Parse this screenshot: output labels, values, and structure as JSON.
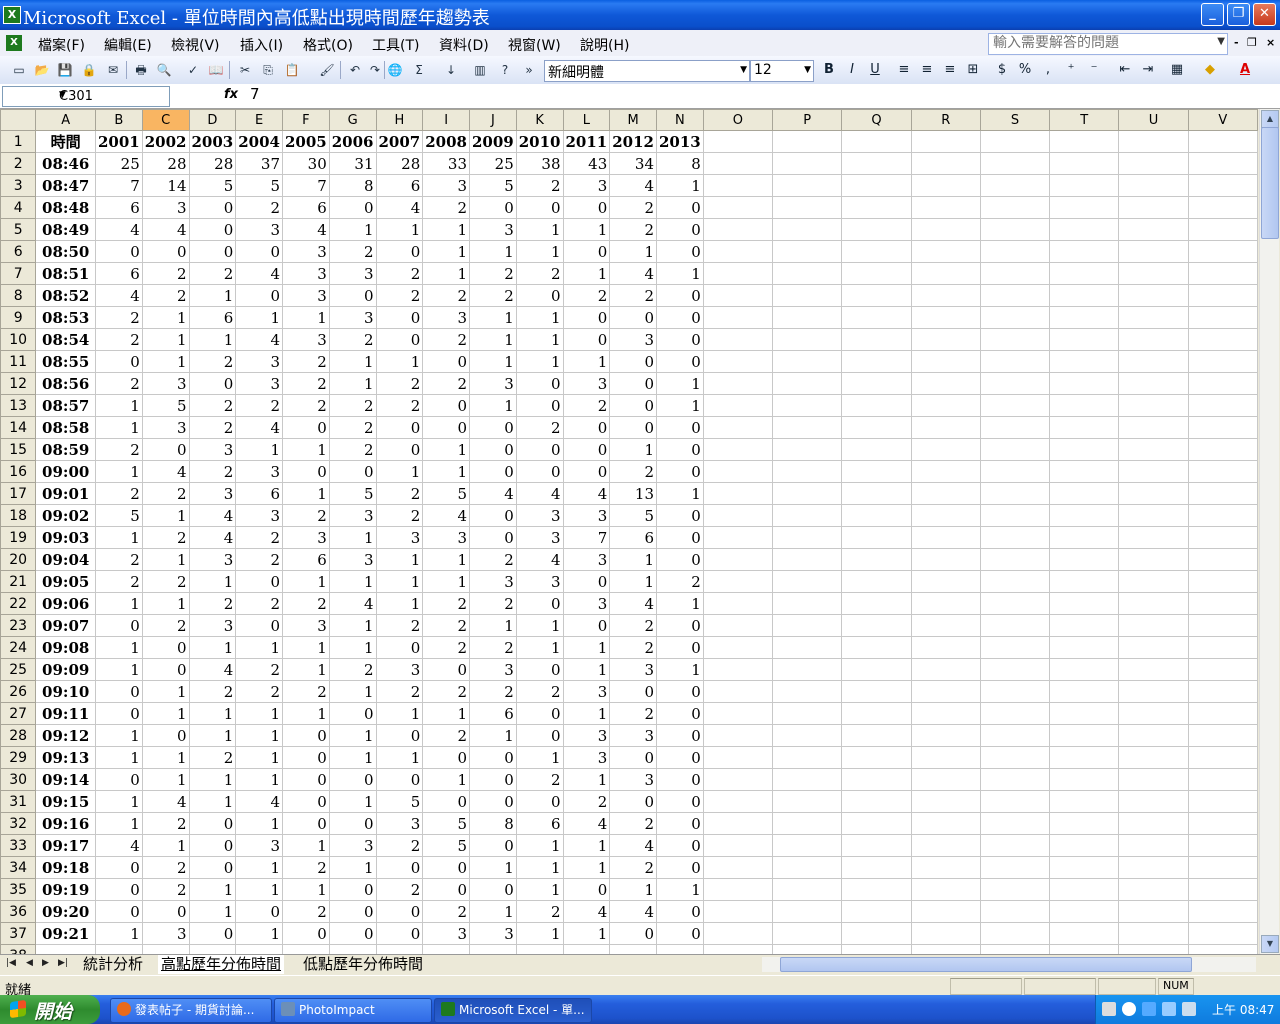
{
  "window": {
    "title": "Microsoft Excel - 單位時間內高低點出現時間歷年趨勢表"
  },
  "menu": {
    "items": [
      "檔案(F)",
      "編輯(E)",
      "檢視(V)",
      "插入(I)",
      "格式(O)",
      "工具(T)",
      "資料(D)",
      "視窗(W)",
      "說明(H)"
    ],
    "help_placeholder": "輸入需要解答的問題"
  },
  "toolbar": {
    "font": "新細明體",
    "size": "12"
  },
  "formula": {
    "cell": "C301",
    "fx": "fx",
    "value": "7"
  },
  "columns": [
    "A",
    "B",
    "C",
    "D",
    "E",
    "F",
    "G",
    "H",
    "I",
    "J",
    "K",
    "L",
    "M",
    "N",
    "O",
    "P",
    "Q",
    "R",
    "S",
    "T",
    "U",
    "V"
  ],
  "selected_column": "C",
  "header_row": [
    "時間",
    "2001",
    "2002",
    "2003",
    "2004",
    "2005",
    "2006",
    "2007",
    "2008",
    "2009",
    "2010",
    "2011",
    "2012",
    "2013"
  ],
  "rows": [
    [
      "08:46",
      25,
      28,
      28,
      37,
      30,
      31,
      28,
      33,
      25,
      38,
      43,
      34,
      8
    ],
    [
      "08:47",
      7,
      14,
      5,
      5,
      7,
      8,
      6,
      3,
      5,
      2,
      3,
      4,
      1
    ],
    [
      "08:48",
      6,
      3,
      0,
      2,
      6,
      0,
      4,
      2,
      0,
      0,
      0,
      2,
      0
    ],
    [
      "08:49",
      4,
      4,
      0,
      3,
      4,
      1,
      1,
      1,
      3,
      1,
      1,
      2,
      0
    ],
    [
      "08:50",
      0,
      0,
      0,
      0,
      3,
      2,
      0,
      1,
      1,
      1,
      0,
      1,
      0
    ],
    [
      "08:51",
      6,
      2,
      2,
      4,
      3,
      3,
      2,
      1,
      2,
      2,
      1,
      4,
      1
    ],
    [
      "08:52",
      4,
      2,
      1,
      0,
      3,
      0,
      2,
      2,
      2,
      0,
      2,
      2,
      0
    ],
    [
      "08:53",
      2,
      1,
      6,
      1,
      1,
      3,
      0,
      3,
      1,
      1,
      0,
      0,
      0
    ],
    [
      "08:54",
      2,
      1,
      1,
      4,
      3,
      2,
      0,
      2,
      1,
      1,
      0,
      3,
      0
    ],
    [
      "08:55",
      0,
      1,
      2,
      3,
      2,
      1,
      1,
      0,
      1,
      1,
      1,
      0,
      0
    ],
    [
      "08:56",
      2,
      3,
      0,
      3,
      2,
      1,
      2,
      2,
      3,
      0,
      3,
      0,
      1
    ],
    [
      "08:57",
      1,
      5,
      2,
      2,
      2,
      2,
      2,
      0,
      1,
      0,
      2,
      0,
      1
    ],
    [
      "08:58",
      1,
      3,
      2,
      4,
      0,
      2,
      0,
      0,
      0,
      2,
      0,
      0,
      0
    ],
    [
      "08:59",
      2,
      0,
      3,
      1,
      1,
      2,
      0,
      1,
      0,
      0,
      0,
      1,
      0
    ],
    [
      "09:00",
      1,
      4,
      2,
      3,
      0,
      0,
      1,
      1,
      0,
      0,
      0,
      2,
      0
    ],
    [
      "09:01",
      2,
      2,
      3,
      6,
      1,
      5,
      2,
      5,
      4,
      4,
      4,
      13,
      1
    ],
    [
      "09:02",
      5,
      1,
      4,
      3,
      2,
      3,
      2,
      4,
      0,
      3,
      3,
      5,
      0
    ],
    [
      "09:03",
      1,
      2,
      4,
      2,
      3,
      1,
      3,
      3,
      0,
      3,
      7,
      6,
      0
    ],
    [
      "09:04",
      2,
      1,
      3,
      2,
      6,
      3,
      1,
      1,
      2,
      4,
      3,
      1,
      0
    ],
    [
      "09:05",
      2,
      2,
      1,
      0,
      1,
      1,
      1,
      1,
      3,
      3,
      0,
      1,
      2
    ],
    [
      "09:06",
      1,
      1,
      2,
      2,
      2,
      4,
      1,
      2,
      2,
      0,
      3,
      4,
      1
    ],
    [
      "09:07",
      0,
      2,
      3,
      0,
      3,
      1,
      2,
      2,
      1,
      1,
      0,
      2,
      0
    ],
    [
      "09:08",
      1,
      0,
      1,
      1,
      1,
      1,
      0,
      2,
      2,
      1,
      1,
      2,
      0
    ],
    [
      "09:09",
      1,
      0,
      4,
      2,
      1,
      2,
      3,
      0,
      3,
      0,
      1,
      3,
      1
    ],
    [
      "09:10",
      0,
      1,
      2,
      2,
      2,
      1,
      2,
      2,
      2,
      2,
      3,
      0,
      0
    ],
    [
      "09:11",
      0,
      1,
      1,
      1,
      1,
      0,
      1,
      1,
      6,
      0,
      1,
      2,
      0
    ],
    [
      "09:12",
      1,
      0,
      1,
      1,
      0,
      1,
      0,
      2,
      1,
      0,
      3,
      3,
      0
    ],
    [
      "09:13",
      1,
      1,
      2,
      1,
      0,
      1,
      1,
      0,
      0,
      1,
      3,
      0,
      0
    ],
    [
      "09:14",
      0,
      1,
      1,
      1,
      0,
      0,
      0,
      1,
      0,
      2,
      1,
      3,
      0
    ],
    [
      "09:15",
      1,
      4,
      1,
      4,
      0,
      1,
      5,
      0,
      0,
      0,
      2,
      0,
      0
    ],
    [
      "09:16",
      1,
      2,
      0,
      1,
      0,
      0,
      3,
      5,
      8,
      6,
      4,
      2,
      0
    ],
    [
      "09:17",
      4,
      1,
      0,
      3,
      1,
      3,
      2,
      5,
      0,
      1,
      1,
      4,
      0
    ],
    [
      "09:18",
      0,
      2,
      0,
      1,
      2,
      1,
      0,
      0,
      1,
      1,
      1,
      2,
      0
    ],
    [
      "09:19",
      0,
      2,
      1,
      1,
      1,
      0,
      2,
      0,
      0,
      1,
      0,
      1,
      1
    ],
    [
      "09:20",
      0,
      0,
      1,
      0,
      2,
      0,
      0,
      2,
      1,
      2,
      4,
      4,
      0
    ],
    [
      "09:21",
      1,
      3,
      0,
      1,
      0,
      0,
      0,
      3,
      3,
      1,
      1,
      0,
      0
    ]
  ],
  "sheets": [
    "統計分析",
    "高點歷年分佈時間",
    "低點歷年分佈時間"
  ],
  "active_sheet": "高點歷年分佈時間",
  "status": {
    "left": "就緒",
    "num": "NUM"
  },
  "taskbar": {
    "start": "開始",
    "tasks": [
      "發表帖子 - 期貨討論...",
      "PhotoImpact",
      "Microsoft Excel - 單..."
    ],
    "clock": "上午 08:47"
  }
}
